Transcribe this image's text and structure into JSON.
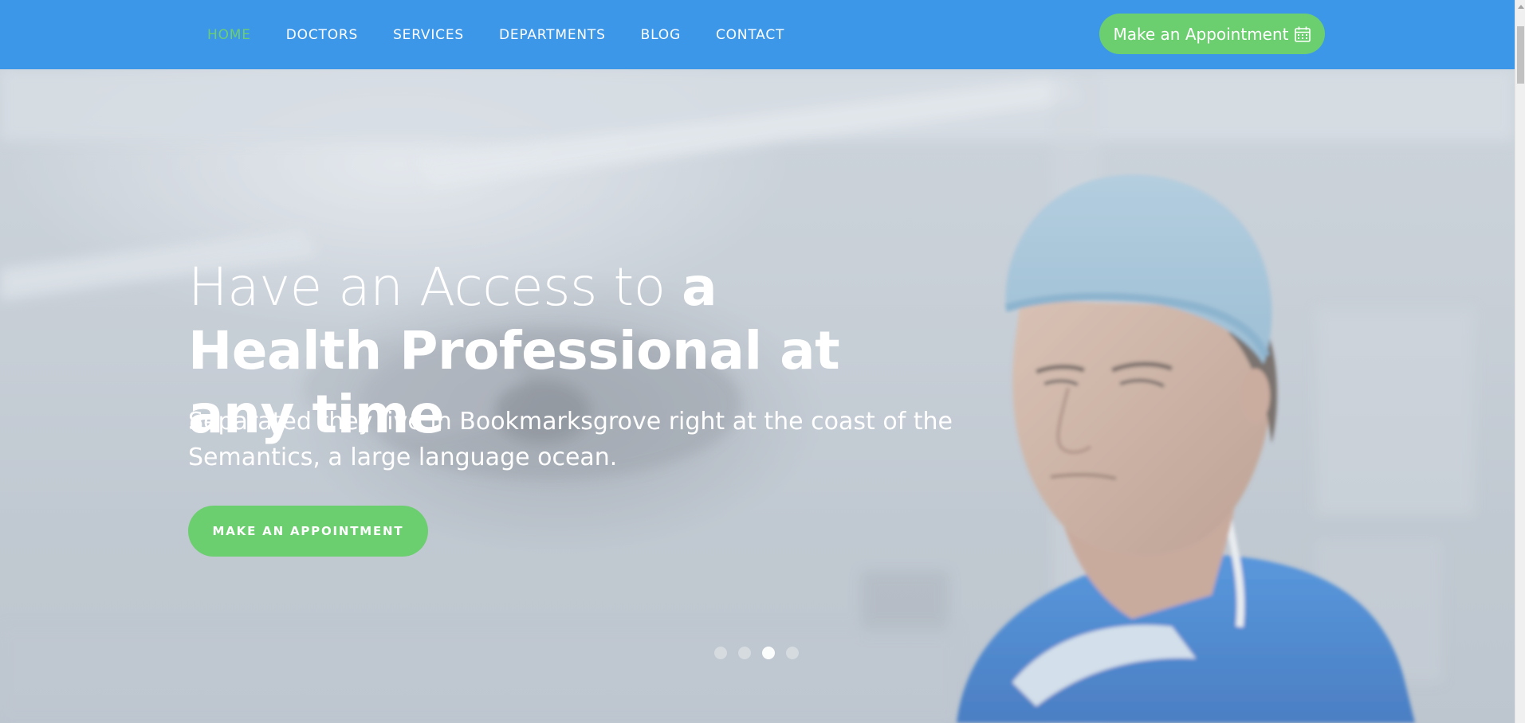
{
  "nav": {
    "items": [
      {
        "label": "HOME",
        "active": true
      },
      {
        "label": "DOCTORS",
        "active": false
      },
      {
        "label": "SERVICES",
        "active": false
      },
      {
        "label": "DEPARTMENTS",
        "active": false
      },
      {
        "label": "BLOG",
        "active": false
      },
      {
        "label": "CONTACT",
        "active": false
      }
    ],
    "cta_label": "Make an Appointment",
    "cta_icon": "calendar-icon"
  },
  "hero": {
    "heading_light": "Have an Access to ",
    "heading_bold": "a Health Professional at any time",
    "subtitle": "Separated they live in Bookmarksgrove right at the coast of the Semantics, a large language ocean.",
    "button_label": "MAKE AN APPOINTMENT",
    "slides_total": 4,
    "active_slide": 3
  },
  "colors": {
    "nav_bg": "#3d97e8",
    "accent_green": "#6ccf6f",
    "text_white": "#ffffff"
  }
}
